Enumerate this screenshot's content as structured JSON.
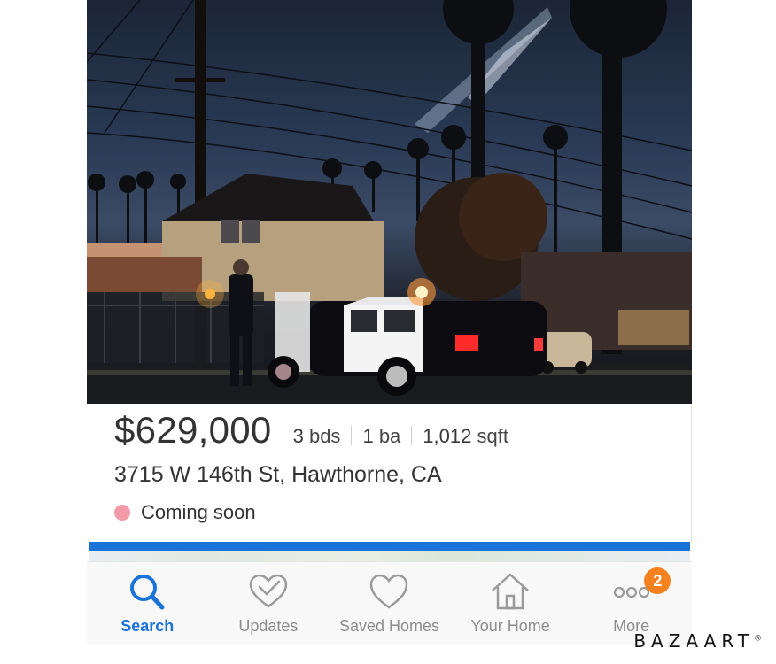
{
  "listing": {
    "price": "$629,000",
    "beds_value": "3",
    "beds_unit": "bds",
    "baths_value": "1",
    "baths_unit": "ba",
    "sqft_value": "1,012",
    "sqft_unit": "sqft",
    "address": "3715 W 146th St, Hawthorne, CA",
    "status": "Coming soon",
    "status_color": "#f29aa8"
  },
  "progress": {
    "fraction": 1.0,
    "color": "#1a73d9"
  },
  "nav": {
    "items": [
      {
        "label": "Search",
        "icon": "search-icon",
        "active": true
      },
      {
        "label": "Updates",
        "icon": "heart-check-icon",
        "active": false
      },
      {
        "label": "Saved Homes",
        "icon": "heart-icon",
        "active": false
      },
      {
        "label": "Your Home",
        "icon": "house-icon",
        "active": false
      },
      {
        "label": "More",
        "icon": "more-dots-icon",
        "active": false,
        "badge": "2"
      }
    ],
    "accent": "#1a73d9",
    "badge_color": "#f5821f"
  },
  "watermark": {
    "text": "BAZAART",
    "mark": "®"
  }
}
